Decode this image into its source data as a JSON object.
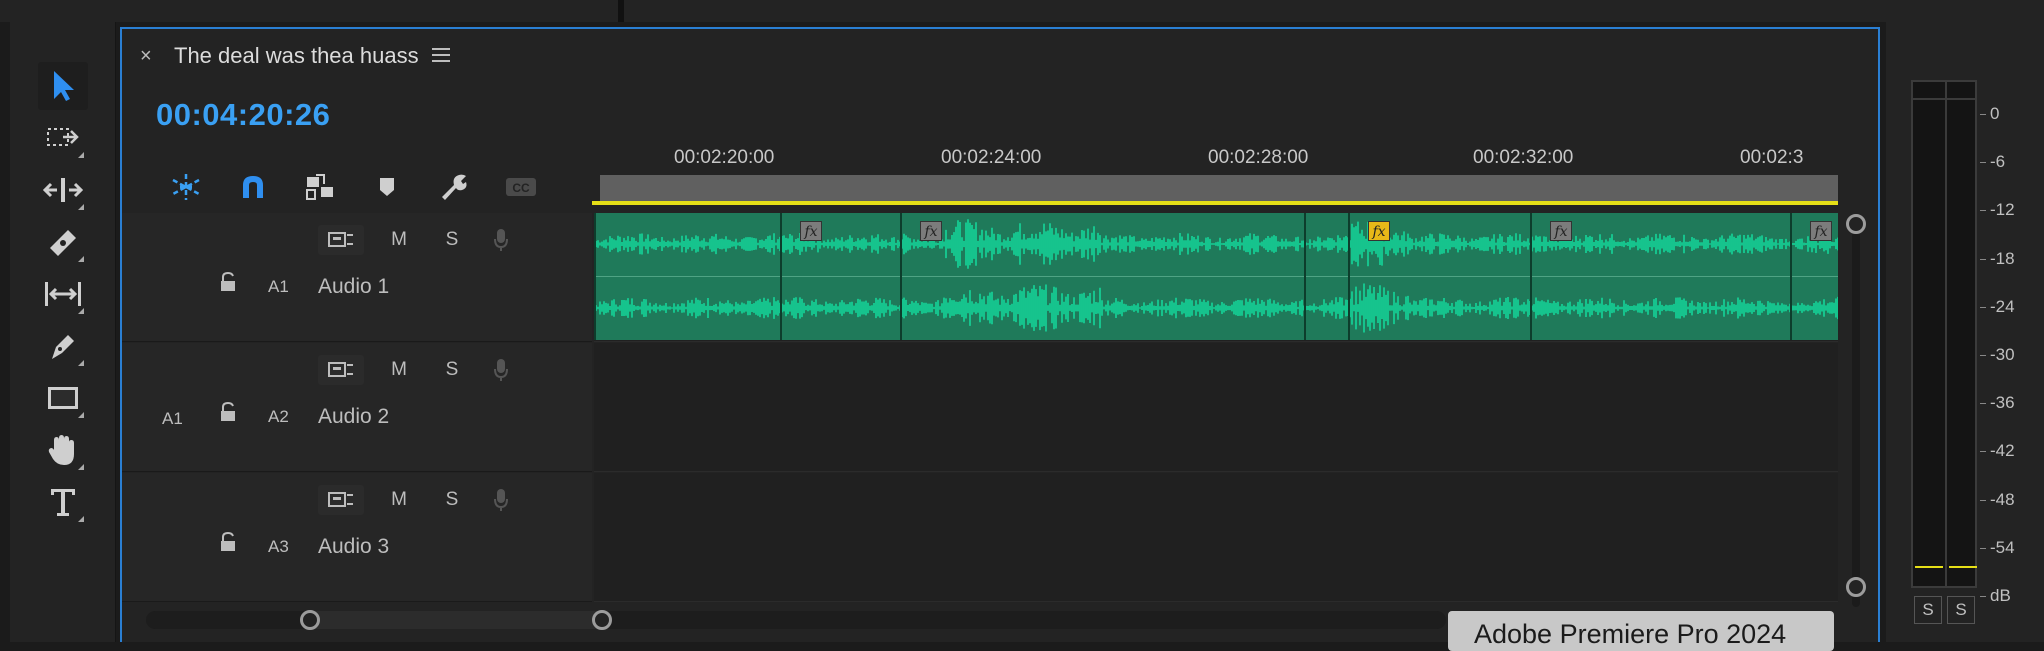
{
  "panel": {
    "sequence_title": "The deal was thea huass",
    "timecode": "00:04:20:26"
  },
  "ruler": {
    "labels": [
      "00:02:20:00",
      "00:02:24:00",
      "00:02:28:00",
      "00:02:32:00",
      "00:02:3"
    ]
  },
  "tracks": [
    {
      "id": "A1",
      "name": "Audio 1",
      "source": "",
      "m": "M",
      "s": "S"
    },
    {
      "id": "A2",
      "name": "Audio 2",
      "source": "A1",
      "m": "M",
      "s": "S"
    },
    {
      "id": "A3",
      "name": "Audio 3",
      "source": "",
      "m": "M",
      "s": "S"
    }
  ],
  "tooltip": "Adobe Premiere Pro 2024",
  "meter": {
    "scale": [
      "0",
      "-6",
      "-12",
      "-18",
      "-24",
      "-30",
      "-36",
      "-42",
      "-48",
      "-54",
      "dB"
    ],
    "solo_left": "S",
    "solo_right": "S"
  },
  "icons": {
    "tools": [
      "selection-tool-icon",
      "track-select-forward-icon",
      "ripple-edit-icon",
      "razor-icon",
      "slip-icon",
      "pen-icon",
      "rectangle-icon",
      "hand-icon",
      "type-icon"
    ],
    "controls": [
      "nest-sequence-icon",
      "snap-magnet-icon",
      "linked-selection-icon",
      "add-marker-icon",
      "timeline-settings-wrench-icon",
      "captions-icon"
    ]
  },
  "colors": {
    "accent_blue": "#3aa0f3",
    "clip_green": "#1f7a5a",
    "waveform": "#15d69a",
    "work_area_yellow": "#e6df17",
    "fx_active": "#e8b818"
  }
}
